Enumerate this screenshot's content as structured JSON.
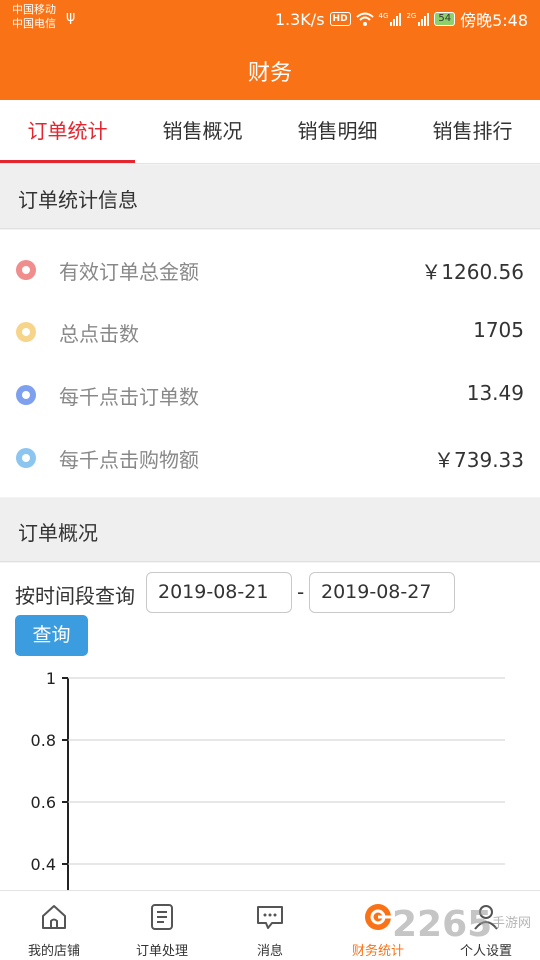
{
  "status_bar": {
    "carrier1": "中国移动",
    "carrier2": "中国电信",
    "speed": "1.3K/s",
    "hd": "HD",
    "net1": "4G",
    "net2": "2G",
    "battery": "54",
    "time": "傍晚5:48"
  },
  "header": {
    "title": "财务"
  },
  "tabs": [
    {
      "label": "订单统计",
      "active": true
    },
    {
      "label": "销售概况",
      "active": false
    },
    {
      "label": "销售明细",
      "active": false
    },
    {
      "label": "销售排行",
      "active": false
    }
  ],
  "stats_section": {
    "title": "订单统计信息",
    "items": [
      {
        "label": "有效订单总金额",
        "value": "￥1260.56",
        "color": "#f08d8d"
      },
      {
        "label": "总点击数",
        "value": "1705",
        "color": "#f6d58a"
      },
      {
        "label": "每千点击订单数",
        "value": "13.49",
        "color": "#7ea0ee"
      },
      {
        "label": "每千点击购物额",
        "value": "￥739.33",
        "color": "#8cc6f0"
      }
    ]
  },
  "overview_section": {
    "title": "订单概况",
    "query_label": "按时间段查询",
    "start_date": "2019-08-21",
    "separator": "-",
    "end_date": "2019-08-27",
    "query_button": "查询"
  },
  "chart_data": {
    "type": "line",
    "y_ticks": [
      "1",
      "0.8",
      "0.6",
      "0.4"
    ],
    "ylim": [
      0.35,
      1
    ],
    "series": []
  },
  "bottom_nav": [
    {
      "label": "我的店铺",
      "icon": "home-icon",
      "active": false
    },
    {
      "label": "订单处理",
      "icon": "document-icon",
      "active": false
    },
    {
      "label": "消息",
      "icon": "message-icon",
      "active": false
    },
    {
      "label": "财务统计",
      "icon": "finance-icon",
      "active": true
    },
    {
      "label": "个人设置",
      "icon": "person-icon",
      "active": false
    }
  ],
  "watermark": {
    "text": "2265",
    "sub": "手游网"
  }
}
